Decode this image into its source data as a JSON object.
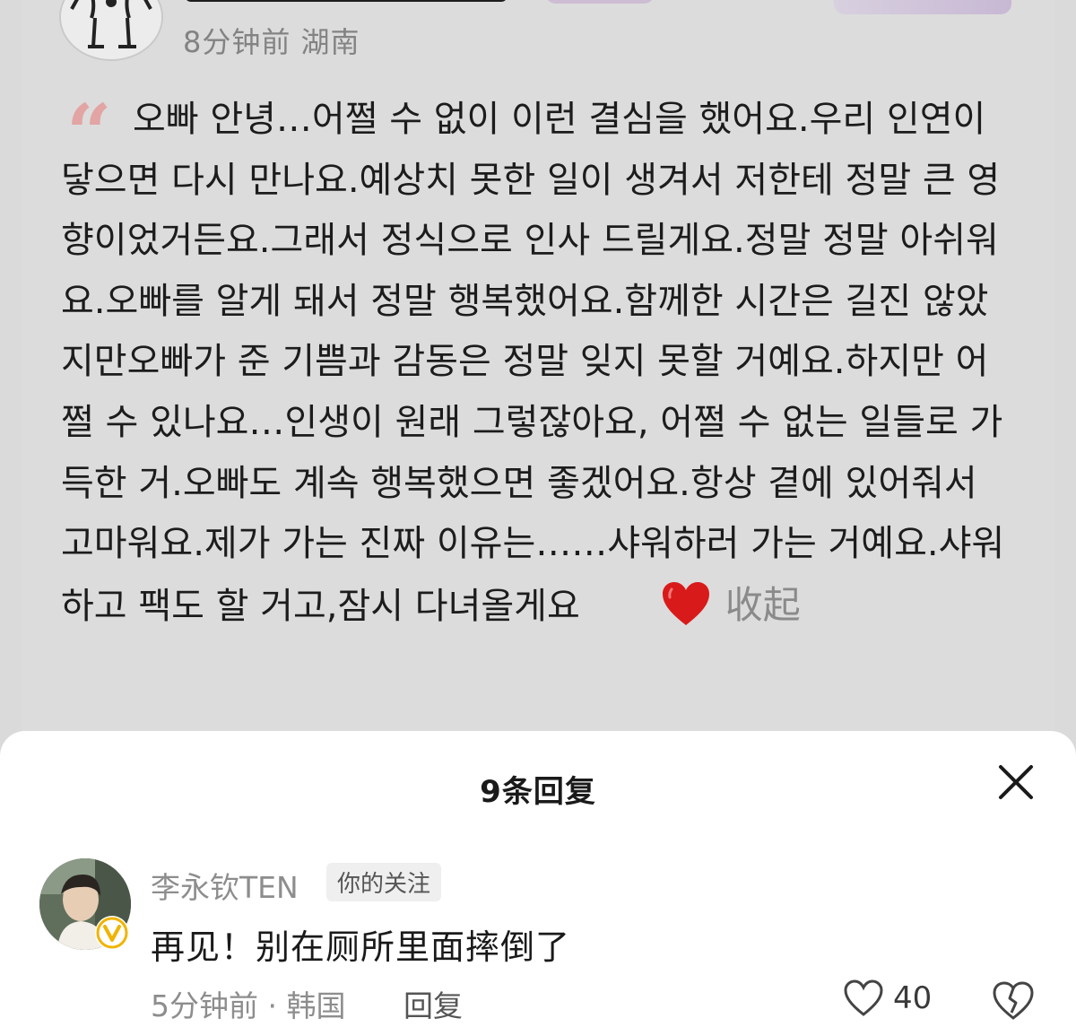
{
  "post": {
    "meta": "8分钟前 湖南",
    "quote_mark": "“",
    "text": "오빠 안녕…어쩔 수 없이 이런 결심을 했어요.우리 인연이 닿으면 다시 만나요.예상치 못한 일이 생겨서 저한테 정말 큰 영향이었거든요.그래서 정식으로 인사 드릴게요.정말 정말 아쉬워요.오빠를 알게 돼서 정말 행복했어요.함께한 시간은 길진 않았지만오빠가 준 기쁨과 감동은 정말 잊지 못할 거예요.하지만 어쩔 수 있나요…인생이 원래 그렇잖아요, 어쩔 수 없는 일들로 가득한 거.오빠도 계속 행복했으면 좋겠어요.항상 곁에 있어줘서 고마워요.제가 가는 진짜 이유는……샤워하러 가는 거예요.샤워하고 팩도 할 거고,잠시 다녀올게요",
    "heart_icon": "red-heart-icon",
    "collapse_label": "收起"
  },
  "sheet": {
    "title": "9条回复",
    "close_icon": "close-icon"
  },
  "reply": {
    "name": "李永钦TEN",
    "follow_tag": "你的关注",
    "content": "再见！别在厕所里面摔倒了",
    "meta": "5分钟前 · 韩国",
    "reply_label": "回复",
    "like_count": "40",
    "like_icon": "heart-outline-icon",
    "dislike_icon": "broken-heart-icon",
    "badge_icon": "verified-v-icon"
  },
  "colors": {
    "overlay_bg": "#dadada",
    "sheet_bg": "#ffffff",
    "quote_mark": "#e3a4a4",
    "badge_gold": "#f0b400",
    "heart_red": "#d91a1a"
  }
}
